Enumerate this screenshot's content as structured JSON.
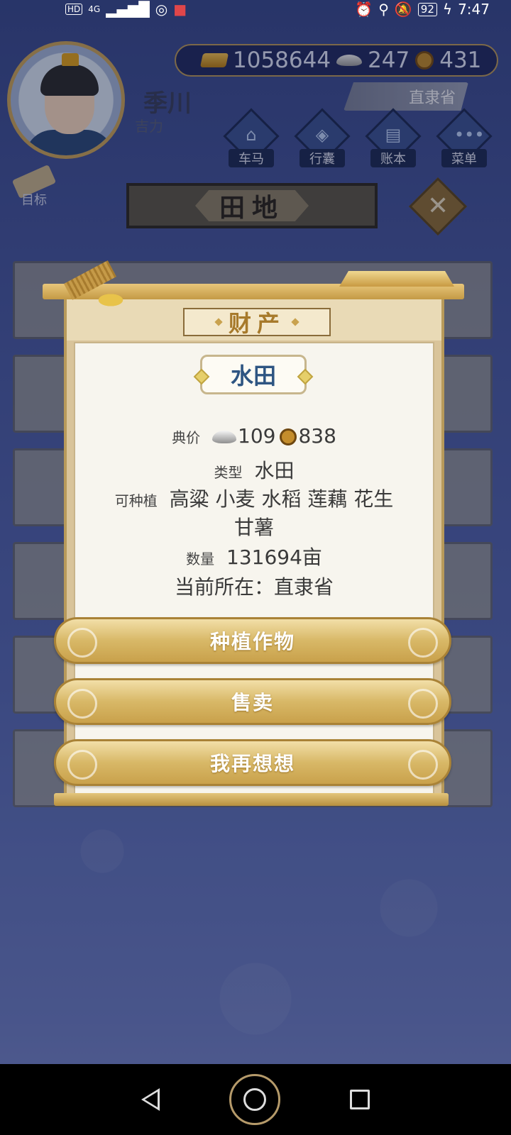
{
  "status_bar": {
    "left_chip": "HD",
    "signal": "4G",
    "battery": "92",
    "time": "7:47"
  },
  "player": {
    "name": "季川",
    "subtitle": "吉力"
  },
  "currency": {
    "gold": "1058644",
    "silver": "247",
    "copper": "431"
  },
  "location": "直隶省",
  "menu": [
    {
      "label": "车马",
      "icon": "carriage-icon"
    },
    {
      "label": "行囊",
      "icon": "bag-icon"
    },
    {
      "label": "账本",
      "icon": "ledger-icon"
    },
    {
      "label": "菜单",
      "icon": "more-icon"
    }
  ],
  "goal_label": "目标",
  "page_title": "田地",
  "modal": {
    "title": "财产",
    "item_name": "水田",
    "price_label": "典价",
    "price_silver": "109",
    "price_copper": "838",
    "type_label": "类型",
    "type_value": "水田",
    "crops_label": "可种植",
    "crops_line1": "高粱 小麦 水稻 莲藕 花生",
    "crops_line2": "甘薯",
    "quantity_label": "数量",
    "quantity_value": "131694亩",
    "location_line": "当前所在：直隶省"
  },
  "buttons": {
    "plant": "种植作物",
    "sell": "售卖",
    "cancel": "我再想想"
  }
}
